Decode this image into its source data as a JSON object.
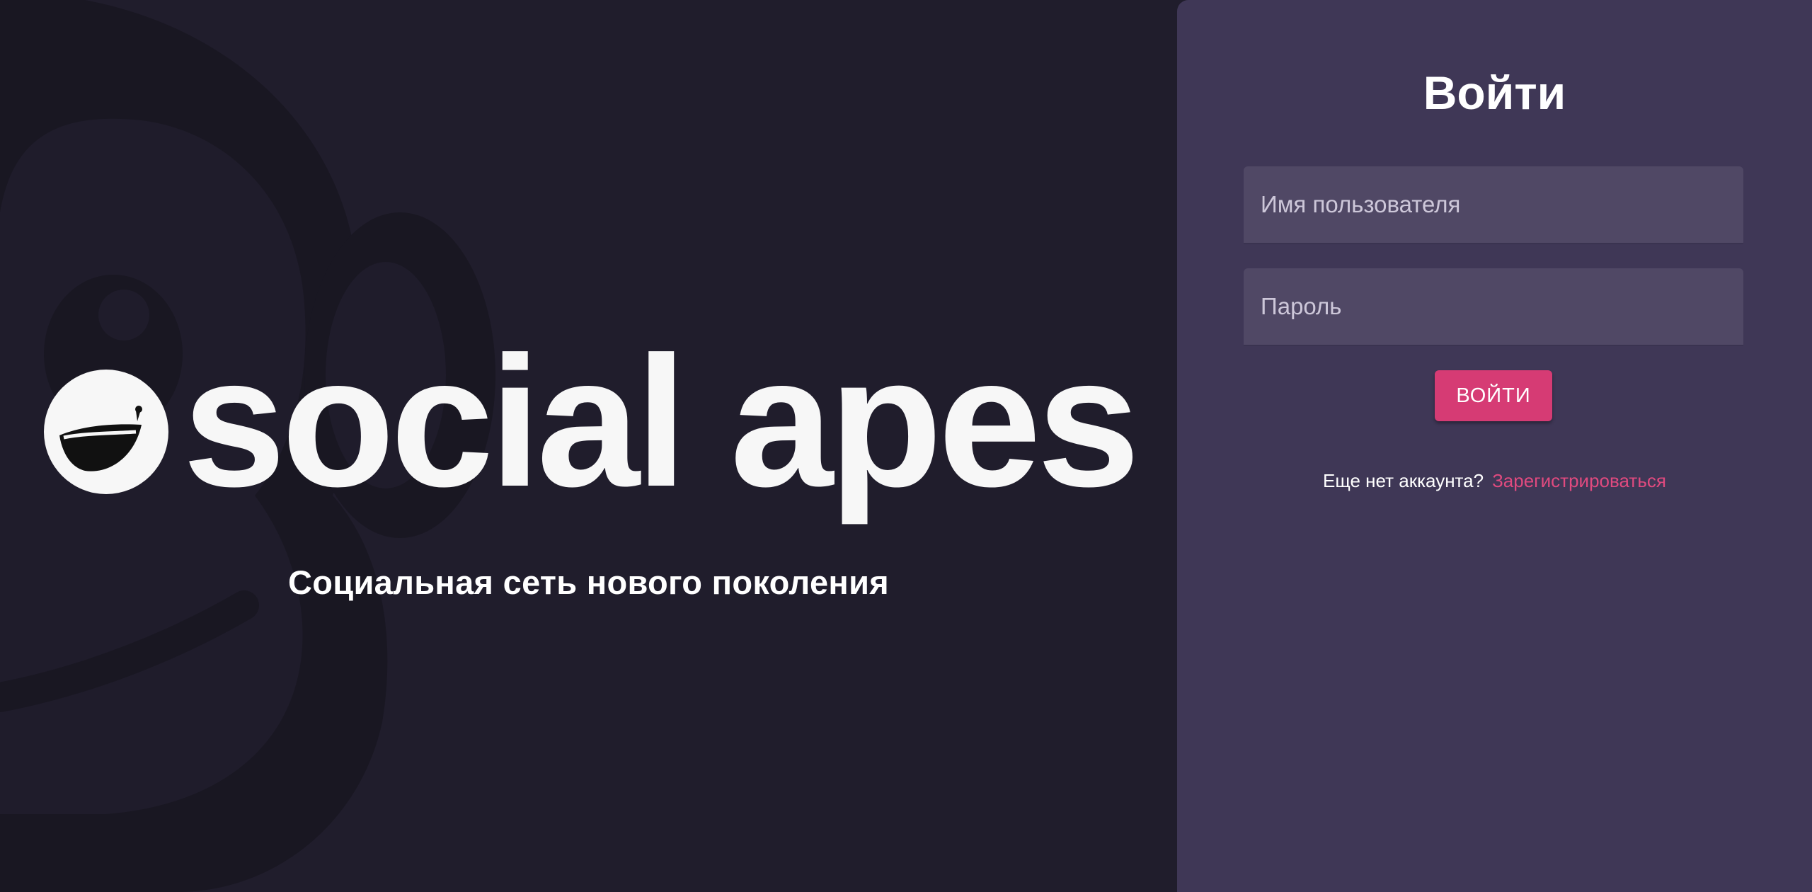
{
  "brand": {
    "name": "social apes",
    "tagline": "Социальная сеть нового поколения"
  },
  "login": {
    "title": "Войти",
    "username_placeholder": "Имя пользователя",
    "password_placeholder": "Пароль",
    "submit_label": "ВОЙТИ",
    "signup_prompt": "Еще нет аккаунта?",
    "signup_link": "Зарегистрироваться"
  },
  "colors": {
    "background": "#201d2c",
    "panel": "#3f3756",
    "input": "#504865",
    "accent": "#d63b74",
    "link": "#e04a7f"
  }
}
